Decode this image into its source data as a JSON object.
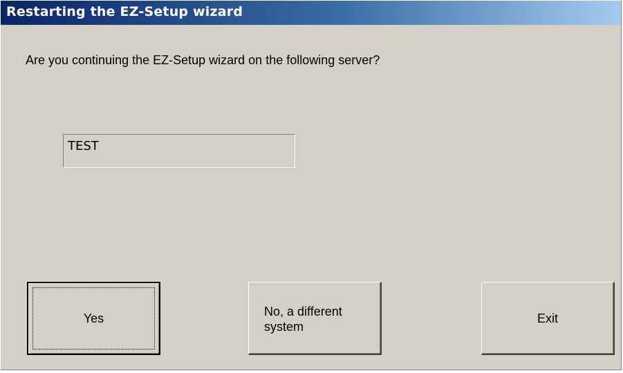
{
  "dialog": {
    "title": "Restarting the EZ-Setup wizard",
    "question": "Are you continuing the EZ-Setup wizard on the following server?",
    "server_name": "TEST"
  },
  "buttons": {
    "yes_label": "Yes",
    "no_label_line1": "No, a different",
    "no_label_line2": "system",
    "exit_label": "Exit"
  }
}
